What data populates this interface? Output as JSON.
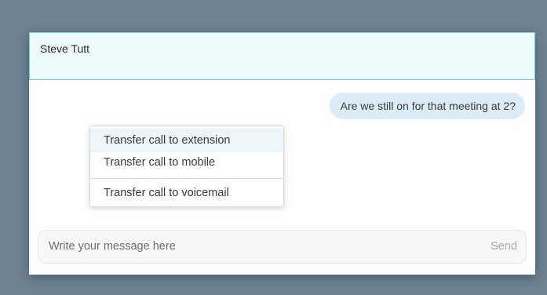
{
  "conversation": {
    "contact_name": "Steve Tutt",
    "messages": [
      {
        "text": "Are we still on for that meeting at 2?"
      }
    ]
  },
  "context_menu": {
    "items": [
      {
        "label": "Transfer call to extension",
        "highlighted": true
      },
      {
        "label": "Transfer call to mobile",
        "highlighted": false
      },
      {
        "label": "Transfer call to voicemail",
        "highlighted": false
      }
    ]
  },
  "composer": {
    "placeholder": "Write your message here",
    "send_label": "Send"
  },
  "colors": {
    "background": "#6f8393",
    "header_background": "#eefbfd",
    "header_border": "#76cdea",
    "bubble_background": "#dcecf7",
    "menu_highlight": "#eef5f8"
  }
}
